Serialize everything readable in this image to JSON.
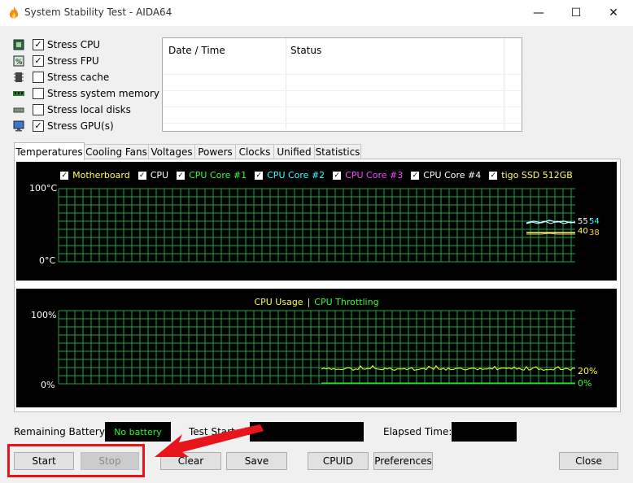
{
  "window": {
    "title": "System Stability Test - AIDA64",
    "minimize_glyph": "—",
    "maximize_glyph": "☐",
    "close_glyph": "✕"
  },
  "stress_options": [
    {
      "label": "Stress CPU",
      "checked": true,
      "icon": "cpu-chip-icon"
    },
    {
      "label": "Stress FPU",
      "checked": true,
      "icon": "fpu-percent-icon"
    },
    {
      "label": "Stress cache",
      "checked": false,
      "icon": "cache-icon"
    },
    {
      "label": "Stress system memory",
      "checked": false,
      "icon": "memory-module-icon"
    },
    {
      "label": "Stress local disks",
      "checked": false,
      "icon": "disk-drive-icon"
    },
    {
      "label": "Stress GPU(s)",
      "checked": true,
      "icon": "monitor-gpu-icon"
    }
  ],
  "status_table": {
    "columns": [
      "Date / Time",
      "Status"
    ]
  },
  "tabs": [
    "Temperatures",
    "Cooling Fans",
    "Voltages",
    "Powers",
    "Clocks",
    "Unified",
    "Statistics"
  ],
  "active_tab": "Temperatures",
  "temperature_graph": {
    "legend": [
      {
        "label": "Motherboard",
        "color": "#ffff66"
      },
      {
        "label": "CPU",
        "color": "#ffffff"
      },
      {
        "label": "CPU Core #1",
        "color": "#33ff33"
      },
      {
        "label": "CPU Core #2",
        "color": "#33ffff"
      },
      {
        "label": "CPU Core #3",
        "color": "#ff44ff"
      },
      {
        "label": "CPU Core #4",
        "color": "#ffffff"
      },
      {
        "label": "tigo SSD 512GB",
        "color": "#ffff66"
      }
    ],
    "y_max_label": "100°C",
    "y_min_label": "0°C",
    "readouts": [
      {
        "text": "55",
        "color": "#ffffff"
      },
      {
        "text": "54",
        "color": "#33ffff"
      },
      {
        "text": "40",
        "color": "#ffff66"
      },
      {
        "text": "38",
        "color": "#ffcc44"
      }
    ]
  },
  "usage_graph": {
    "legend_usage": "CPU Usage",
    "legend_separator": "|",
    "legend_throttling": "CPU Throttling",
    "usage_color": "#ffff33",
    "throttling_color": "#33ff33",
    "y_max_label": "100%",
    "y_min_label": "0%",
    "usage_readout": "20%",
    "throttling_readout": "0%"
  },
  "status_bar": {
    "remaining_battery_label": "Remaining Battery:",
    "remaining_battery_value": "No battery",
    "test_started_label": "Test Started:",
    "elapsed_time_label": "Elapsed Time:"
  },
  "buttons": {
    "start": "Start",
    "stop": "Stop",
    "clear": "Clear",
    "save": "Save",
    "cpuid": "CPUID",
    "preferences": "Preferences",
    "close": "Close"
  },
  "annotation": {
    "color": "#e8141c"
  }
}
